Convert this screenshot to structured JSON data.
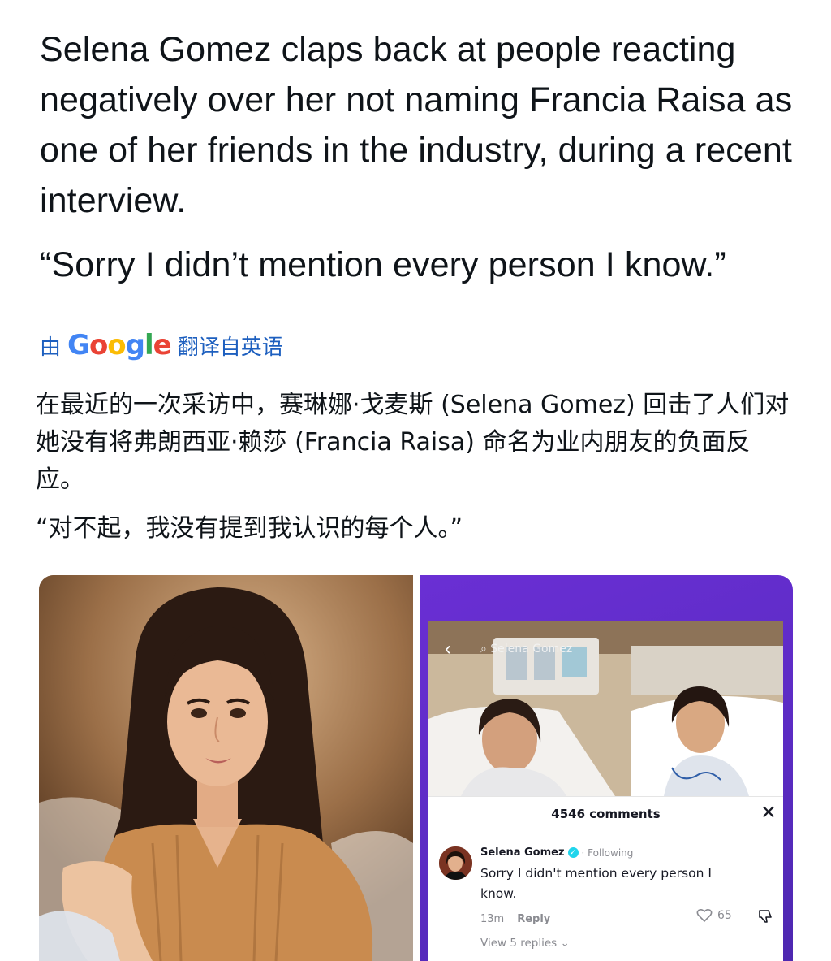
{
  "tweet": {
    "text": "Selena Gomez claps back at people reacting negatively over her not naming Francia Raisa as one of her friends in the industry, during a recent interview.",
    "quote": "“Sorry I didn’t mention every person I know.”"
  },
  "translate": {
    "prefix": "由",
    "brand": "Google",
    "suffix": "翻译自英语"
  },
  "translation": {
    "paragraph": "在最近的一次采访中，赛琳娜·戈麦斯 (Selena Gomez) 回击了人们对她没有将弗朗西亚·赖莎 (Francia Raisa) 命名为业内朋友的负面反应。",
    "quote": "“对不起，我没有提到我认识的每个人。”"
  },
  "screenshot": {
    "search_label": "Selena Gomez",
    "comments_count": "4546 comments",
    "comment": {
      "author": "Selena Gomez",
      "follow_status": "· Following",
      "text": "Sorry I didn't mention every person I know.",
      "time": "13m",
      "reply_label": "Reply",
      "likes": "65"
    },
    "view_replies": "View 5 replies"
  },
  "colors": {
    "translate_link": "#1d5fbf",
    "right_panel_bg": "#5a2bc2",
    "verified": "#20d5ec"
  }
}
